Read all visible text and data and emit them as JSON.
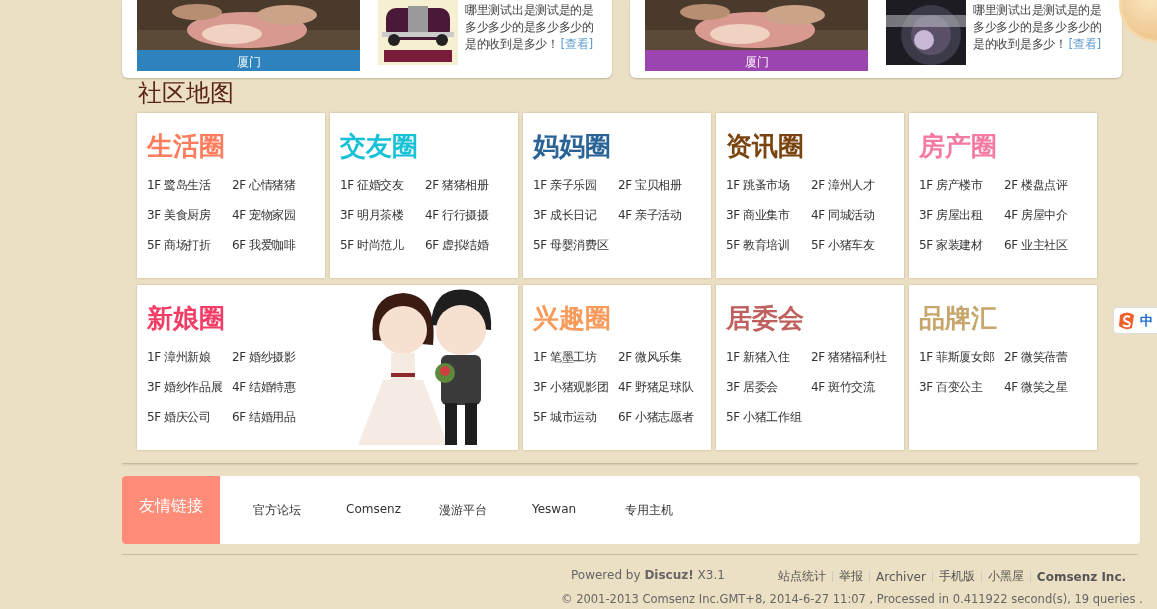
{
  "featured": [
    {
      "caption": "厦门",
      "color": "#2e82be",
      "kind": "car",
      "text": "哪里测试出是测试是的是多少多少的是多少多少的是的收到是多少！",
      "link": "[查看]"
    },
    {
      "caption": "厦门",
      "color": "#9c44b0",
      "kind": "lens",
      "text": "哪里测试出是测试是的是多少多少的是多少多少的是的收到是多少！",
      "link": "[查看]"
    }
  ],
  "section_title": "社区地图",
  "circles": [
    {
      "kind": "plain",
      "title": "生活圈",
      "color": "#ff7c5c",
      "items": [
        "1F 鹭岛生活",
        "2F 心情猪猪",
        "3F 美食厨房",
        "4F 宠物家园",
        "5F 商场打折",
        "6F 我爱咖啡"
      ]
    },
    {
      "kind": "plain",
      "title": "交友圈",
      "color": "#18c2d6",
      "items": [
        "1F 征婚交友",
        "2F 猪猪相册",
        "3F 明月茶楼",
        "4F 行行摄摄",
        "5F 时尚范儿",
        "6F 虚拟结婚"
      ]
    },
    {
      "kind": "plain",
      "title": "妈妈圈",
      "color": "#2a6496",
      "items": [
        "1F 亲子乐园",
        "2F 宝贝相册",
        "3F 成长日记",
        "4F 亲子活动",
        "5F 母婴消费区"
      ]
    },
    {
      "kind": "plain",
      "title": "资讯圈",
      "color": "#7a4410",
      "items": [
        "1F 跳蚤市场",
        "2F 漳州人才",
        "3F 商业集市",
        "4F 同城活动",
        "5F 教育培训",
        "5F 小猪车友"
      ]
    },
    {
      "kind": "plain",
      "title": "房产圈",
      "color": "#f47aa0",
      "items": [
        "1F 房产楼市",
        "2F 楼盘点评",
        "3F 房屋出租",
        "4F 房屋中介",
        "5F 家装建材",
        "6F 业主社区"
      ]
    },
    {
      "kind": "with-picture",
      "title": "新娘圈",
      "color": "#f23e66",
      "items": [
        "1F 漳州新娘",
        "2F 婚纱摄影",
        "3F 婚纱作品展",
        "4F 结婚特惠",
        "5F 婚庆公司",
        "6F 结婚用品"
      ]
    },
    {
      "kind": "plain",
      "title": "兴趣圈",
      "color": "#f89a5a",
      "items": [
        "1F 笔墨工坊",
        "2F 微风乐集",
        "3F 小猪观影团",
        "4F 野猪足球队",
        "5F 城市运动",
        "6F 小猪志愿者"
      ]
    },
    {
      "kind": "plain",
      "title": "居委会",
      "color": "#c0605e",
      "items": [
        "1F 新猪入住",
        "2F 猪猪福利社",
        "3F 居委会",
        "4F 斑竹交流",
        "5F 小猪工作组"
      ]
    },
    {
      "kind": "plain",
      "title": "品牌汇",
      "color": "#c6a66a",
      "items": [
        "1F 菲斯厦女郎",
        "2F 微笑蓓蕾",
        "3F 百变公主",
        "4F 微笑之星"
      ]
    }
  ],
  "friend_links": {
    "label": "友情链接",
    "links": [
      "官方论坛",
      "Comsenz",
      "漫游平台",
      "Yeswan",
      "专用主机"
    ]
  },
  "footer": {
    "powered": "Powered by **Discuz!** X3.1",
    "links": [
      {
        "text": "站点统计",
        "bold": false
      },
      {
        "text": "举报",
        "bold": false
      },
      {
        "text": "Archiver",
        "bold": false
      },
      {
        "text": "手机版",
        "bold": false
      },
      {
        "text": "小黑屋",
        "bold": false
      },
      {
        "text": "Comsenz Inc.",
        "bold": true
      }
    ],
    "copyright": "© 2001-2013 Comsenz Inc.GMT+8, 2014-6-27 11:07 , Processed in 0.411922 second(s), 19 queries ."
  },
  "ime_toolbar": {
    "mode": "中"
  }
}
